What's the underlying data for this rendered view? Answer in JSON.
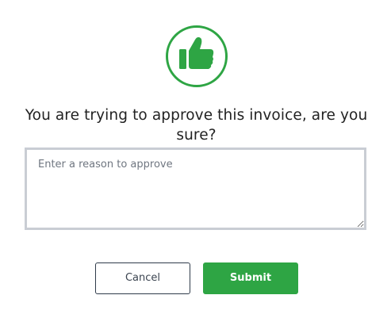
{
  "dialog": {
    "title": "You are trying to approve this invoice, are you sure?",
    "icon": "thumbs-up-icon",
    "reason": {
      "value": "",
      "placeholder": "Enter a reason to approve"
    },
    "buttons": {
      "cancel_label": "Cancel",
      "submit_label": "Submit"
    }
  },
  "colors": {
    "accent": "#2ea544",
    "input_border": "#c9cdd4",
    "cancel_border": "#2f3b4a",
    "text": "#222222"
  }
}
